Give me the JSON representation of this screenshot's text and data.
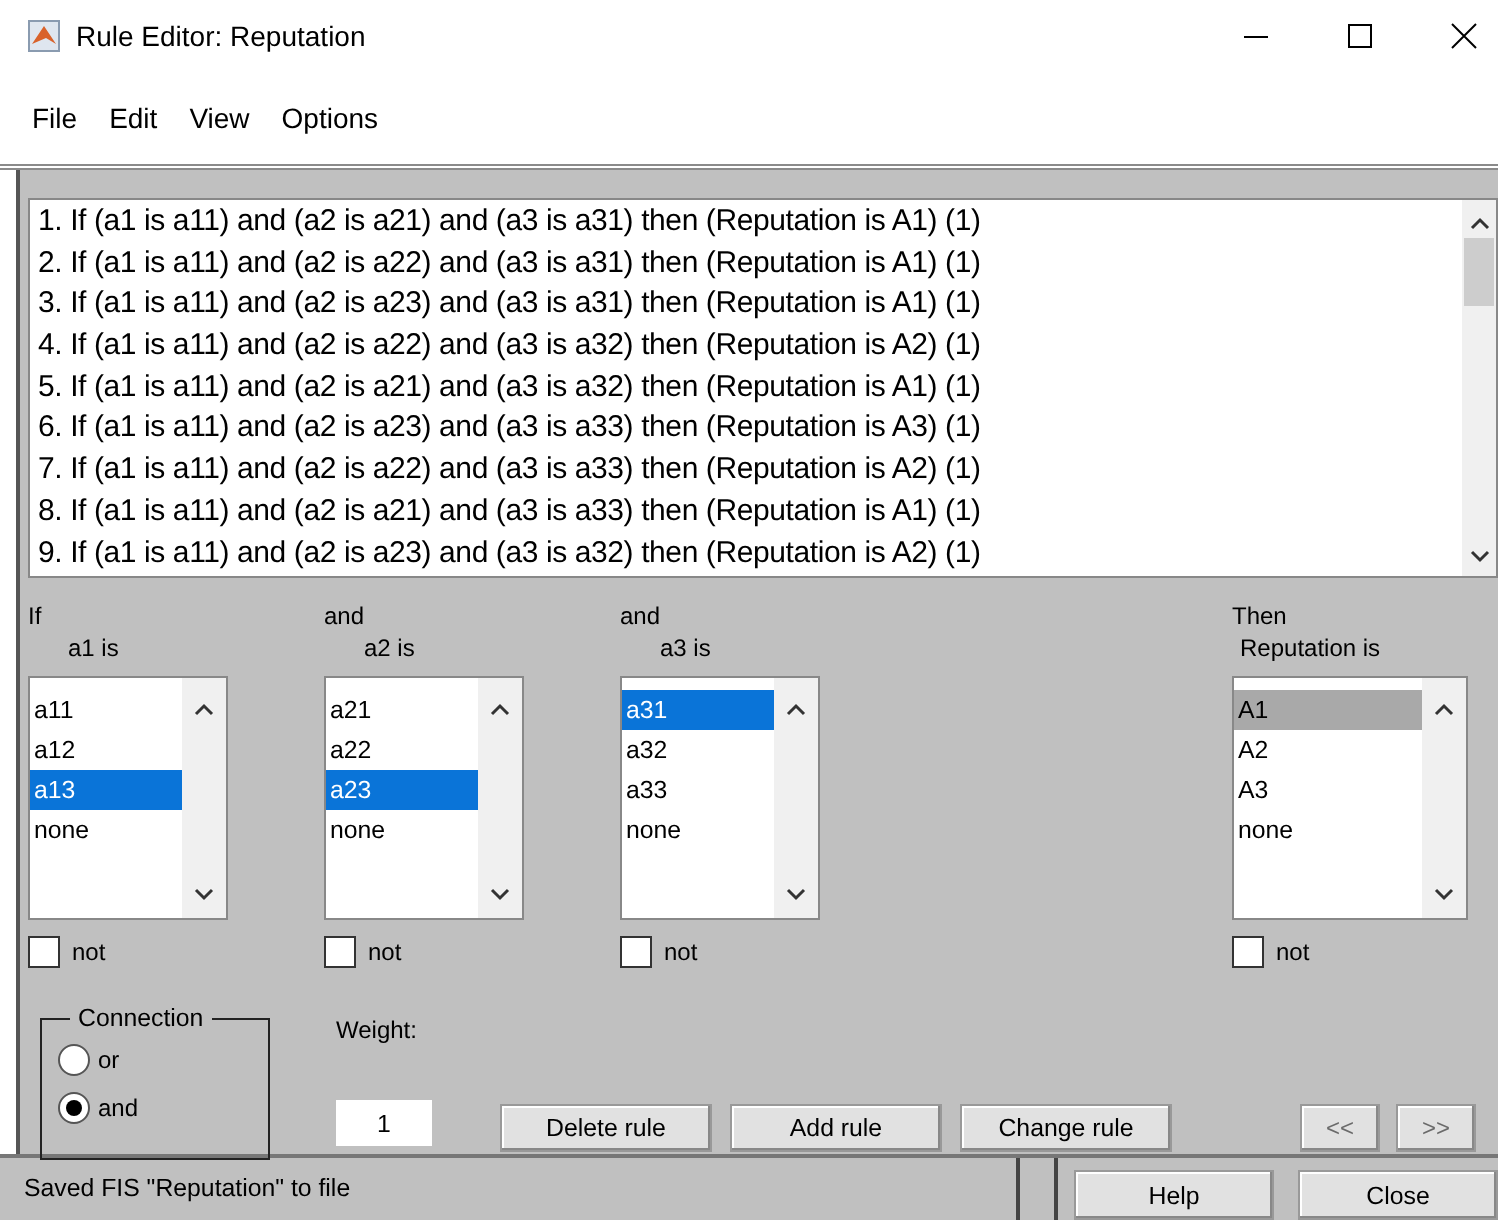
{
  "window": {
    "title": "Rule Editor: Reputation"
  },
  "menu": [
    "File",
    "Edit",
    "View",
    "Options"
  ],
  "rules": [
    "1. If (a1 is a11) and (a2 is a21) and (a3 is a31) then (Reputation is A1) (1)",
    "2. If (a1 is a11) and (a2 is a22) and (a3 is a31) then (Reputation is A1) (1)",
    "3. If (a1 is a11) and (a2 is a23) and (a3 is a31) then (Reputation is A1) (1)",
    "4. If (a1 is a11) and (a2 is a22) and (a3 is a32) then (Reputation is A2) (1)",
    "5. If (a1 is a11) and (a2 is a21) and (a3 is a32) then (Reputation is A1) (1)",
    "6. If (a1 is a11) and (a2 is a23) and (a3 is a33) then (Reputation is A3) (1)",
    "7. If (a1 is a11) and (a2 is a22) and (a3 is a33) then (Reputation is A2) (1)",
    "8. If (a1 is a11) and (a2 is a21) and (a3 is a33) then (Reputation is A1) (1)",
    "9. If (a1 is a11) and (a2 is a23) and (a3 is a32) then (Reputation is A2) (1)"
  ],
  "columns": [
    {
      "connector": "If",
      "label": "a1 is",
      "selection_active": true,
      "items": [
        {
          "label": "a11",
          "selected": false
        },
        {
          "label": "a12",
          "selected": false
        },
        {
          "label": "a13",
          "selected": true
        },
        {
          "label": "none",
          "selected": false
        }
      ],
      "not_label": "not",
      "not_checked": false
    },
    {
      "connector": "and",
      "label": "a2 is",
      "selection_active": true,
      "items": [
        {
          "label": "a21",
          "selected": false
        },
        {
          "label": "a22",
          "selected": false
        },
        {
          "label": "a23",
          "selected": true
        },
        {
          "label": "none",
          "selected": false
        }
      ],
      "not_label": "not",
      "not_checked": false
    },
    {
      "connector": "and",
      "label": "a3 is",
      "selection_active": true,
      "items": [
        {
          "label": "a31",
          "selected": true
        },
        {
          "label": "a32",
          "selected": false
        },
        {
          "label": "a33",
          "selected": false
        },
        {
          "label": "none",
          "selected": false
        }
      ],
      "not_label": "not",
      "not_checked": false
    },
    {
      "connector": "Then",
      "label": "Reputation is",
      "selection_active": false,
      "items": [
        {
          "label": "A1",
          "selected": true
        },
        {
          "label": "A2",
          "selected": false
        },
        {
          "label": "A3",
          "selected": false
        },
        {
          "label": "none",
          "selected": false
        }
      ],
      "not_label": "not",
      "not_checked": false
    }
  ],
  "connection": {
    "title": "Connection",
    "options": [
      {
        "label": "or",
        "selected": false
      },
      {
        "label": "and",
        "selected": true
      }
    ]
  },
  "weight": {
    "label": "Weight:",
    "value": "1"
  },
  "actions": [
    "Delete rule",
    "Add rule",
    "Change rule"
  ],
  "nav_buttons": [
    {
      "label": "<<",
      "disabled": true
    },
    {
      "label": ">>",
      "disabled": true
    }
  ],
  "status": "Saved FIS \"Reputation\" to file",
  "footer_buttons": [
    "Help",
    "Close"
  ]
}
